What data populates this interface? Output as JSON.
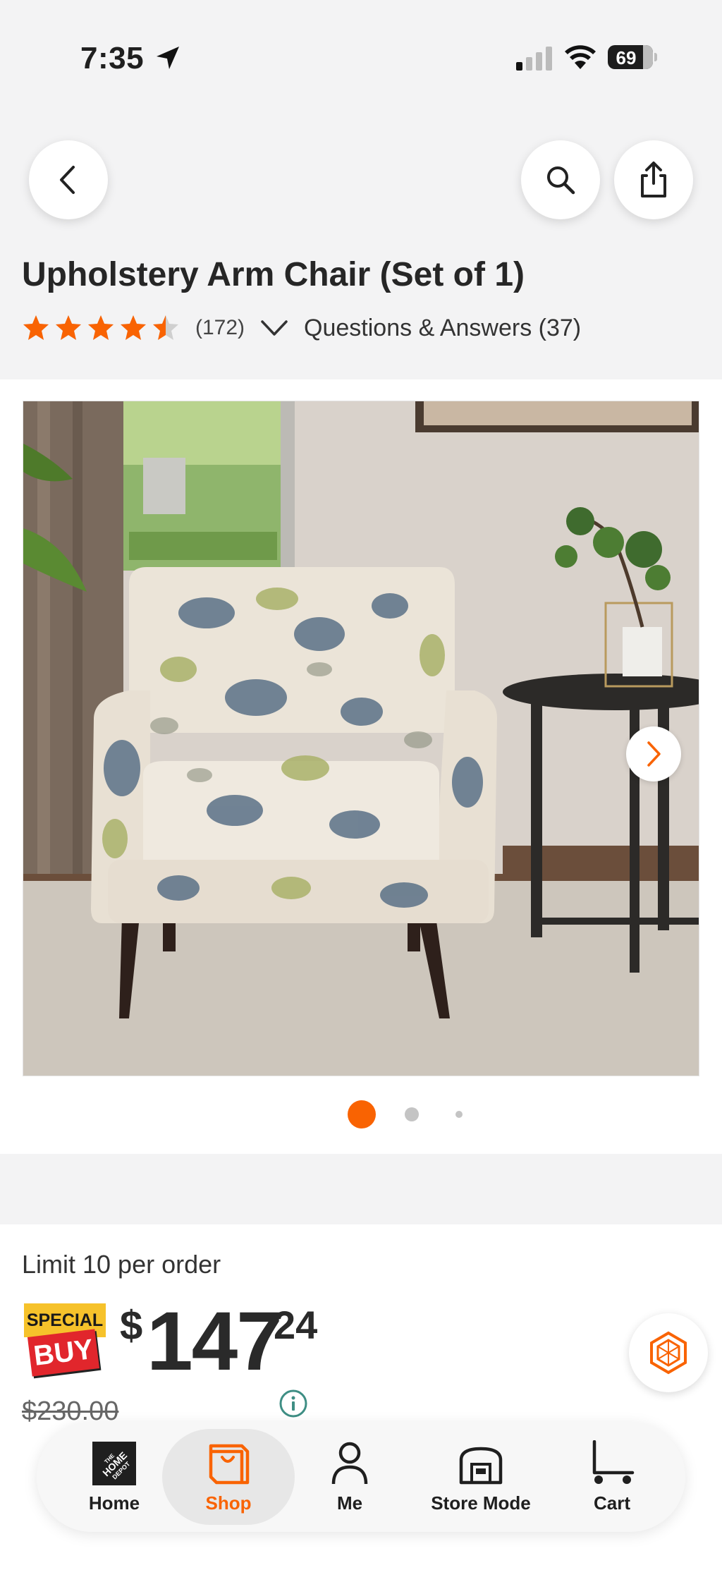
{
  "status_bar": {
    "time": "7:35",
    "battery": "69"
  },
  "product": {
    "title": "Upholstery Arm Chair (Set of 1)",
    "rating": 4.5,
    "review_count": "(172)",
    "qa_label": "Questions & Answers (37)",
    "image_count": 3,
    "active_image": 1
  },
  "pricing": {
    "limit": "Limit 10 per order",
    "badge_top": "SPECIAL",
    "badge_bottom": "BUY",
    "currency": "$",
    "dollars": "147",
    "cents": "24",
    "was_price": "$230.00"
  },
  "tabs": [
    {
      "label": "Home",
      "icon": "home-depot-logo-icon"
    },
    {
      "label": "Shop",
      "icon": "shop-bag-icon"
    },
    {
      "label": "Me",
      "icon": "person-icon"
    },
    {
      "label": "Store Mode",
      "icon": "store-icon"
    },
    {
      "label": "Cart",
      "icon": "cart-icon"
    }
  ],
  "colors": {
    "brand_orange": "#f96302",
    "star_orange": "#f96302",
    "badge_yellow": "#f6c22b",
    "badge_red": "#e1262c",
    "info_teal": "#3e8e84"
  }
}
